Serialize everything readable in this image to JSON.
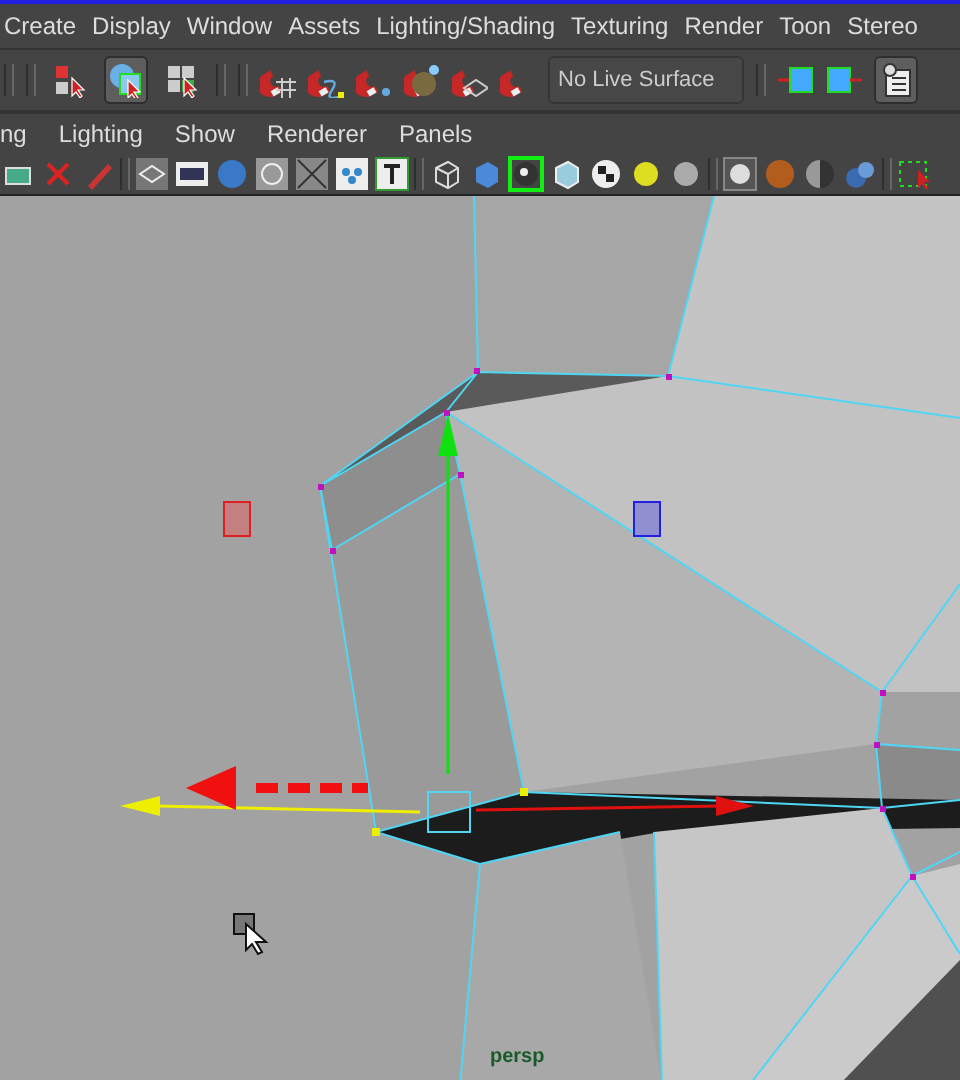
{
  "menu_bar": {
    "items": [
      "Create",
      "Display",
      "Window",
      "Assets",
      "Lighting/Shading",
      "Texturing",
      "Render",
      "Toon",
      "Stereo"
    ]
  },
  "status_line": {
    "selection_mode_buttons": [
      {
        "selected": false
      },
      {
        "selected": true
      },
      {
        "selected": false
      }
    ],
    "live_surface_field": "No Live Surface"
  },
  "panel_menu": {
    "items": [
      "ng",
      "Lighting",
      "Show",
      "Renderer",
      "Panels"
    ]
  },
  "viewport": {
    "camera_label": "persp"
  }
}
